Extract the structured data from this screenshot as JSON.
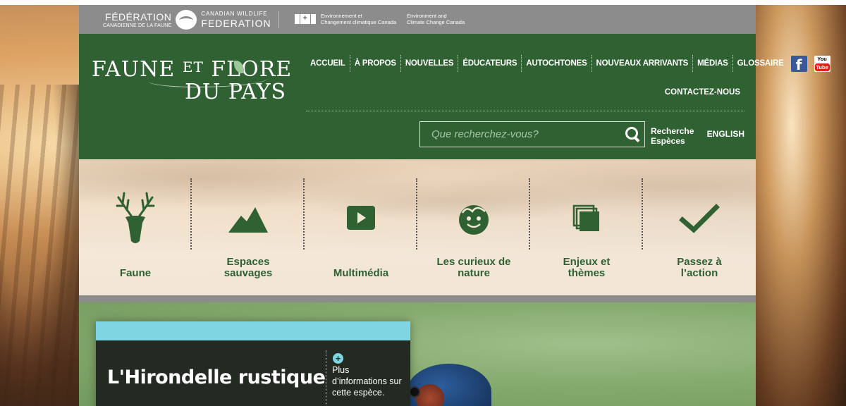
{
  "govbar": {
    "fed_fr_big": "FÉDÉRATION",
    "fed_fr_small": "CANADIENNE DE LA FAUNE",
    "fed_en_small": "CANADIAN WILDLIFE",
    "fed_en_big": "FEDERATION",
    "eccc_fr_1": "Environnement et",
    "eccc_fr_2": "Changement climatique Canada",
    "eccc_en_1": "Environment and",
    "eccc_en_2": "Climate Change Canada"
  },
  "logo": {
    "line1a": "FAUNE",
    "line1b": "ET",
    "line1c": "FLORE",
    "line2": "DU PAYS"
  },
  "nav": {
    "items": [
      "ACCUEIL",
      "À PROPOS",
      "NOUVELLES",
      "ÉDUCATEURS",
      "AUTOCHTONES",
      "NOUVEAUX ARRIVANTS",
      "MÉDIAS",
      "GLOSSAIRE"
    ],
    "facebook": "f",
    "youtube_top": "You",
    "youtube_bot": "Tube",
    "contact": "CONTACTEZ-NOUS"
  },
  "search": {
    "placeholder": "Que recherchez-vous?",
    "species_line1": "Recherche",
    "species_line2": "Espèces",
    "lang": "ENGLISH"
  },
  "categories": [
    {
      "label": "Faune",
      "icon": "deer-icon"
    },
    {
      "label": "Espaces sauvages",
      "icon": "mountain-icon"
    },
    {
      "label": "Multimédia",
      "icon": "play-icon"
    },
    {
      "label": "Les curieux de nature",
      "icon": "kid-face-icon"
    },
    {
      "label": "Enjeux et thèmes",
      "icon": "layers-icon"
    },
    {
      "label": "Passez à l’action",
      "icon": "checkmark-icon"
    }
  ],
  "feature": {
    "title": "L'Hirondelle rustique",
    "more_icon": "+",
    "more_text": "Plus d’informations sur cette espèce."
  },
  "colors": {
    "header_green": "#2f6132",
    "gov_grey": "#8c8c8c",
    "accent_cyan": "#7fd5e2"
  }
}
